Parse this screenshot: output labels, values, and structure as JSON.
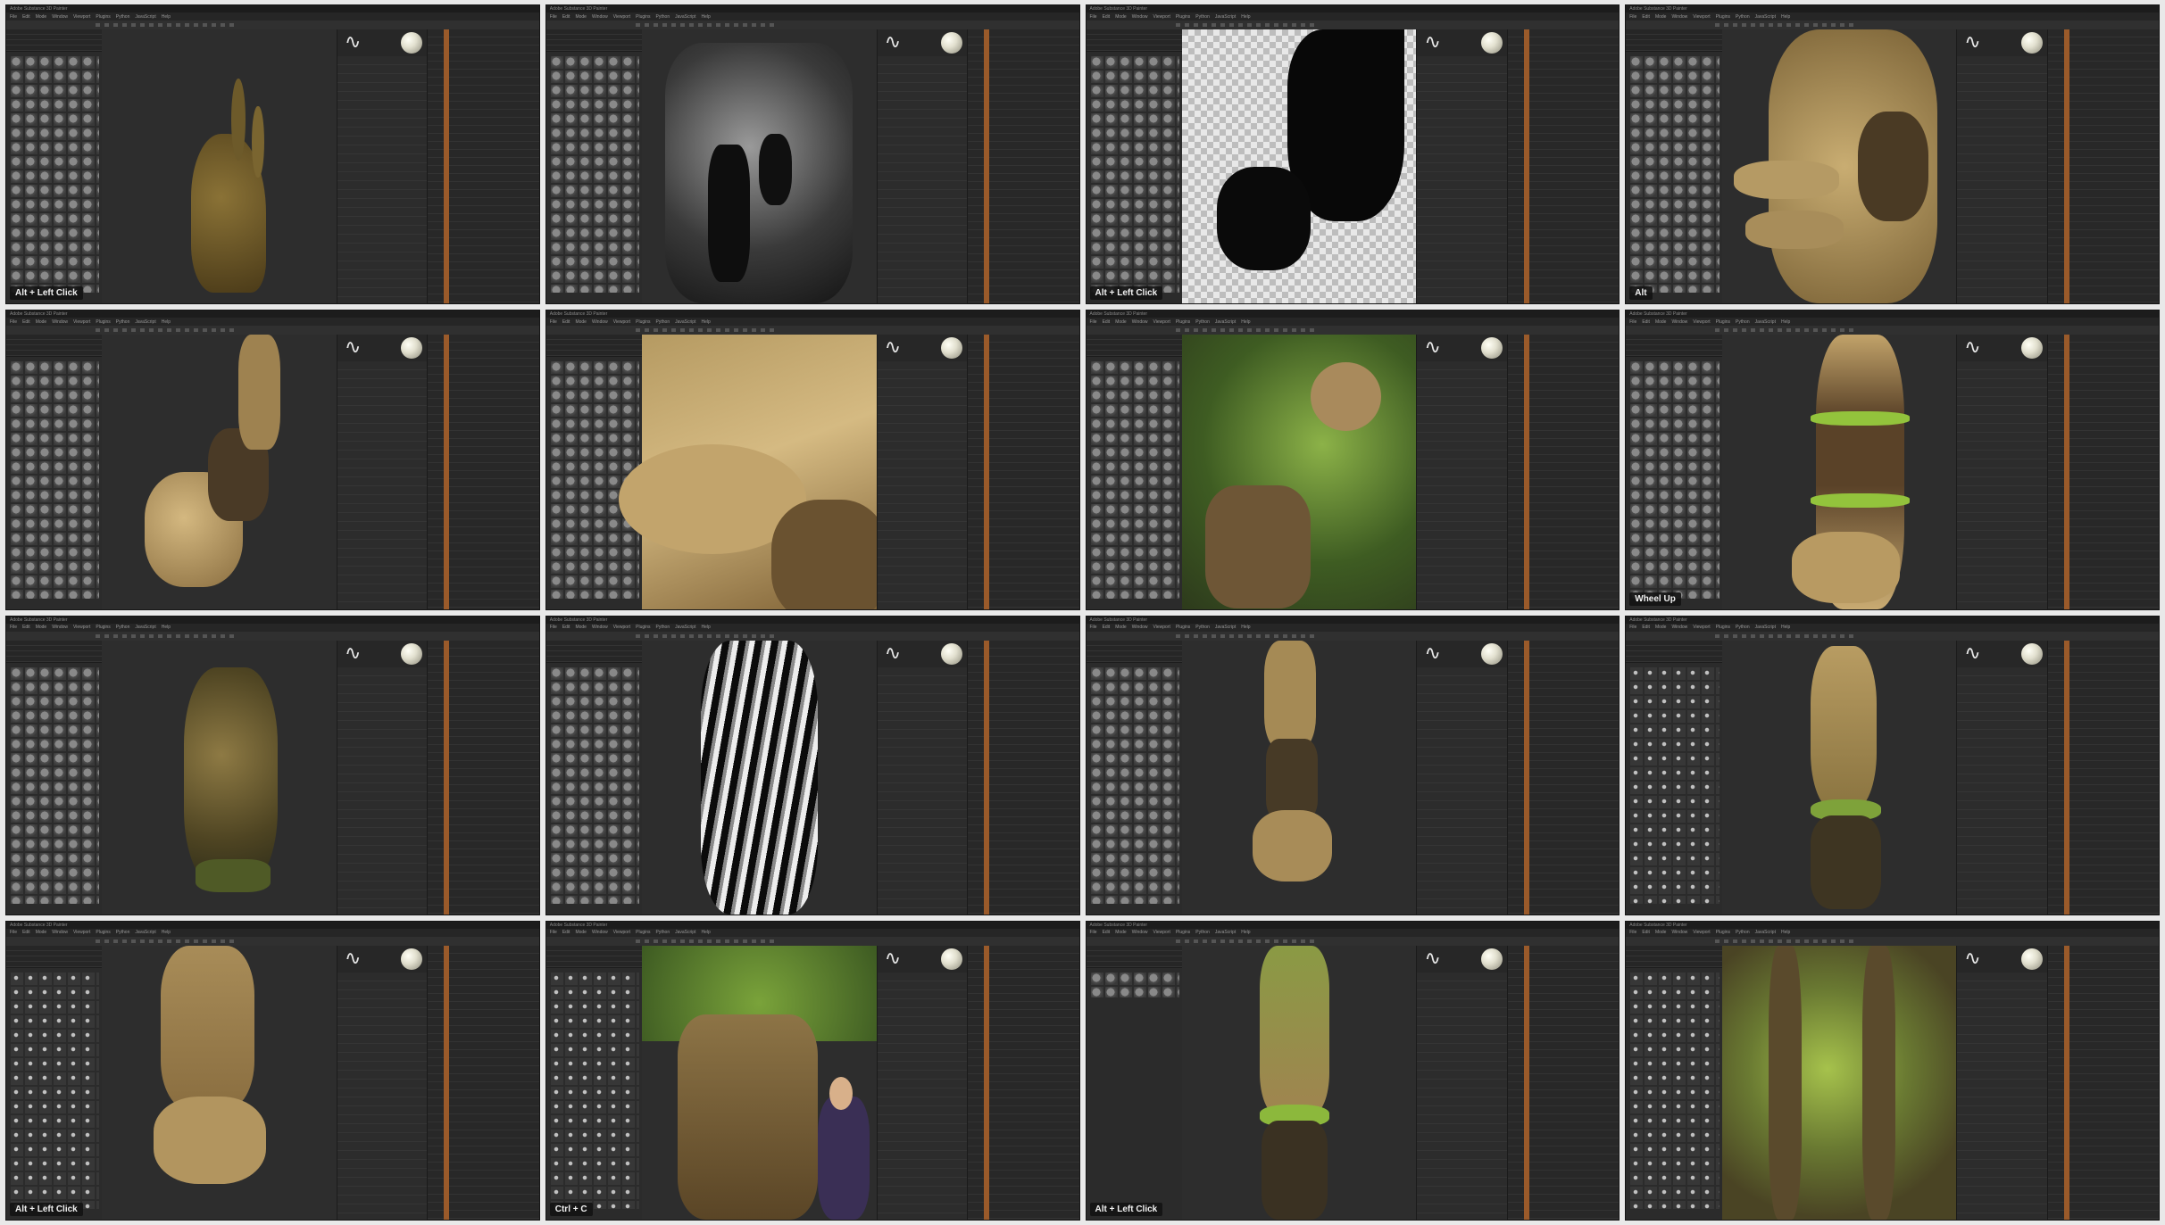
{
  "app": {
    "window_title": "Adobe Substance 3D Painter",
    "menu": [
      "File",
      "Edit",
      "Mode",
      "Window",
      "Viewport",
      "Plugins",
      "Python",
      "JavaScript",
      "Help"
    ]
  },
  "tiles": [
    {
      "scene": "roots",
      "left_panel": "materials",
      "keys": "Alt + Left Click"
    },
    {
      "scene": "grayscale",
      "left_panel": "materials",
      "keys": ""
    },
    {
      "scene": "checker",
      "left_panel": "materials",
      "keys": "Alt + Left Click"
    },
    {
      "scene": "hand-closeup",
      "left_panel": "materials",
      "keys": "Alt"
    },
    {
      "scene": "hand",
      "left_panel": "materials",
      "keys": ""
    },
    {
      "scene": "limb-closeup",
      "left_panel": "materials",
      "keys": ""
    },
    {
      "scene": "foliage",
      "left_panel": "materials",
      "keys": ""
    },
    {
      "scene": "arm-green",
      "left_panel": "materials",
      "keys": "Wheel Up"
    },
    {
      "scene": "limb-dark",
      "left_panel": "textures",
      "keys": ""
    },
    {
      "scene": "bw-texture",
      "left_panel": "textures",
      "keys": ""
    },
    {
      "scene": "leg",
      "left_panel": "textures",
      "keys": ""
    },
    {
      "scene": "leg-green",
      "left_panel": "brushes",
      "keys": ""
    },
    {
      "scene": "foot",
      "left_panel": "brushes",
      "keys": "Alt + Left Click"
    },
    {
      "scene": "character",
      "left_panel": "brushes",
      "keys": "Ctrl + C"
    },
    {
      "scene": "leg-moss",
      "left_panel": "few",
      "keys": "Alt + Left Click"
    },
    {
      "scene": "bark-detail",
      "left_panel": "brushes",
      "keys": ""
    }
  ],
  "colors": {
    "ui_bg": "#2a2a2a",
    "layer_accent": "#9a5a2a",
    "bark": "#9a8248",
    "moss": "#7aa33a"
  }
}
